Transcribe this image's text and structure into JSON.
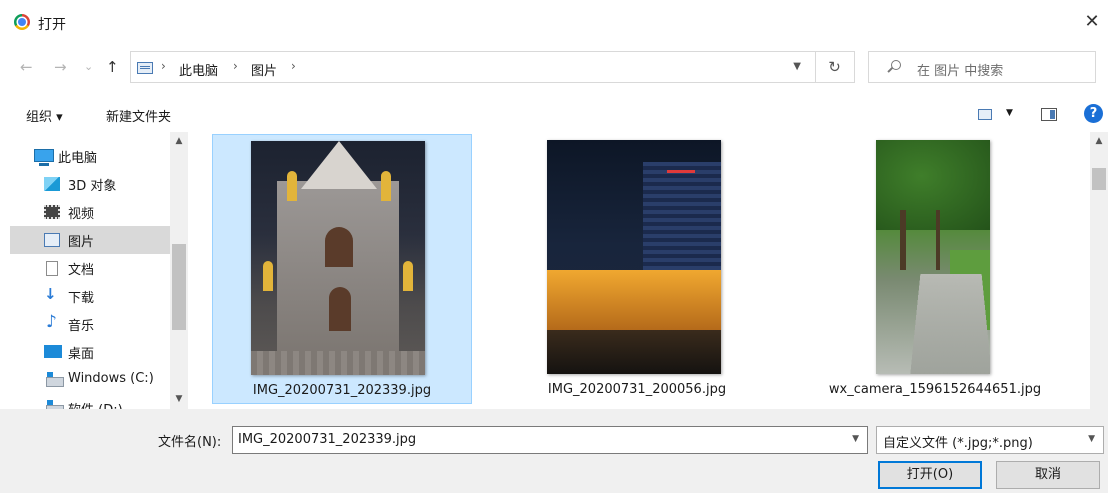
{
  "window": {
    "title": "打开",
    "close_glyph": "✕"
  },
  "nav": {
    "back_glyph": "←",
    "forward_glyph": "→",
    "recent_glyph": "⌄",
    "up_glyph": "↑",
    "breadcrumb": [
      {
        "label": "此电脑"
      },
      {
        "label": "图片"
      }
    ],
    "refresh_glyph": "↻",
    "search_placeholder": "在 图片 中搜索"
  },
  "toolbar": {
    "organize_label": "组织 ▾",
    "new_folder_label": "新建文件夹",
    "help_glyph": "?"
  },
  "sidebar": {
    "items": [
      {
        "label": "此电脑",
        "icon": "computer-icon"
      },
      {
        "label": "3D 对象",
        "icon": "3d-objects-icon"
      },
      {
        "label": "视频",
        "icon": "video-icon"
      },
      {
        "label": "图片",
        "icon": "pictures-icon",
        "selected": true
      },
      {
        "label": "文档",
        "icon": "documents-icon"
      },
      {
        "label": "下载",
        "icon": "download-icon"
      },
      {
        "label": "音乐",
        "icon": "music-icon"
      },
      {
        "label": "桌面",
        "icon": "desktop-icon"
      },
      {
        "label": "Windows (C:)",
        "icon": "drive-icon"
      },
      {
        "label": "软件 (D:)",
        "icon": "drive-icon"
      }
    ]
  },
  "files": [
    {
      "name": "IMG_20200731_202339.jpg",
      "selected": true
    },
    {
      "name": "IMG_20200731_200056.jpg",
      "selected": false
    },
    {
      "name": "wx_camera_1596152644651.jpg",
      "selected": false
    }
  ],
  "footer": {
    "filename_label": "文件名(N):",
    "filename_value": "IMG_20200731_202339.jpg",
    "filetype_value": "自定义文件 (*.jpg;*.png)",
    "open_label": "打开(O)",
    "cancel_label": "取消"
  },
  "colors": {
    "selection": "#cce8ff",
    "accent": "#0078d7",
    "help": "#1a6fd6"
  }
}
